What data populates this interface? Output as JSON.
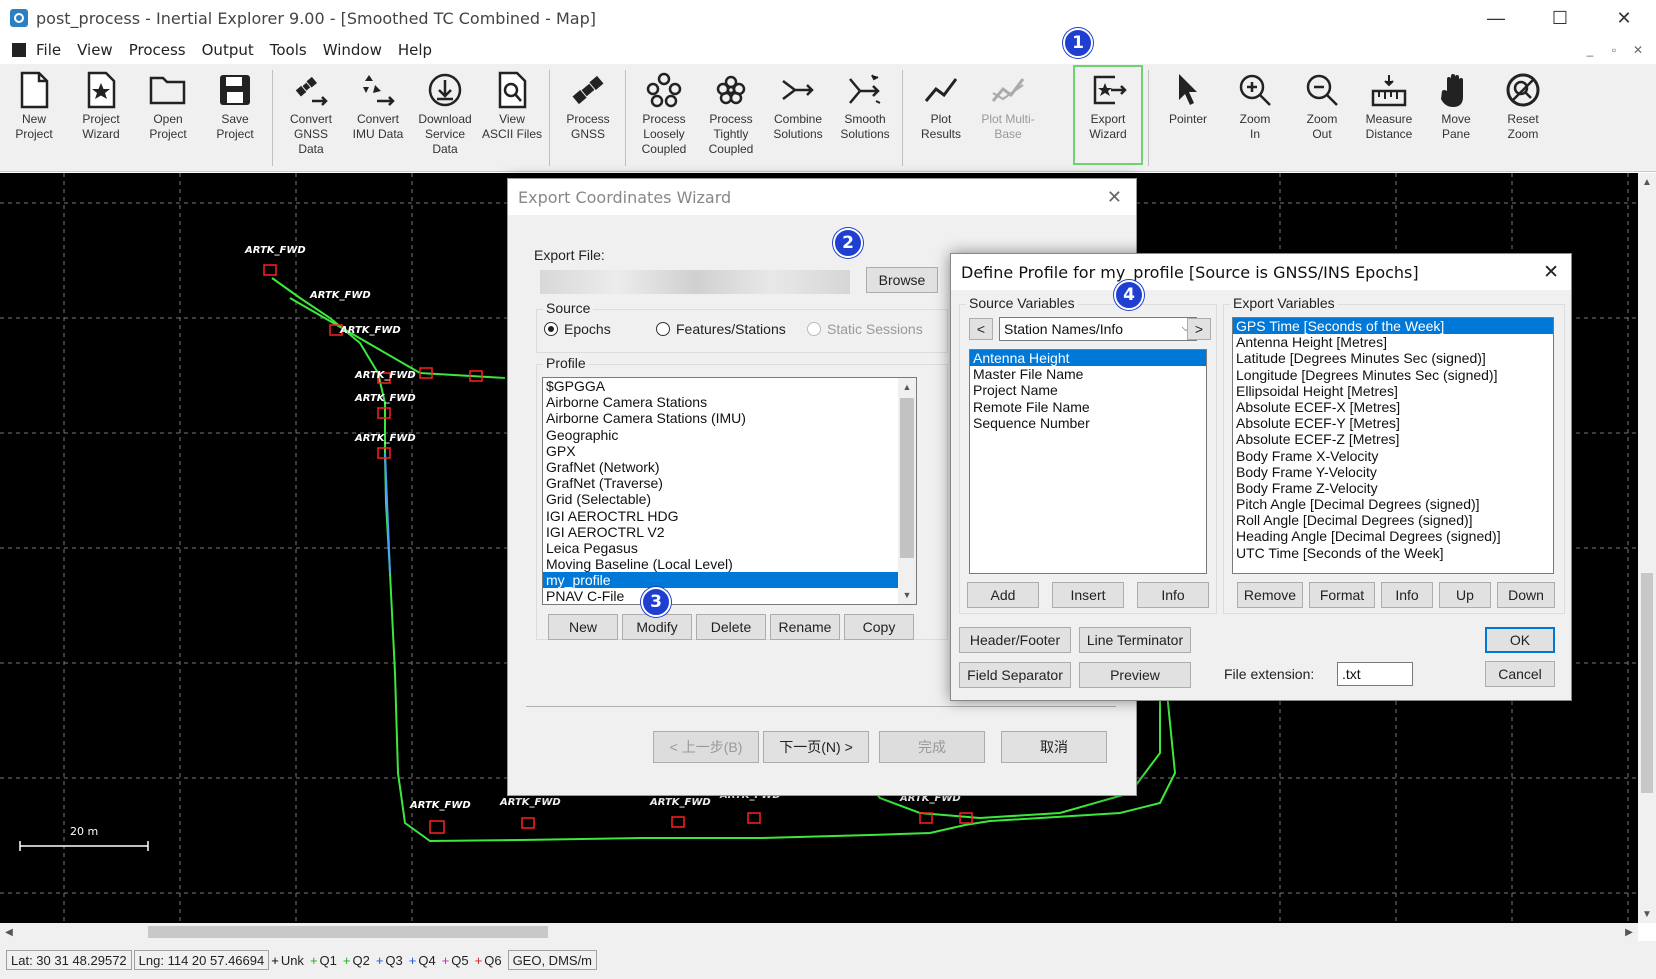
{
  "window": {
    "title": "post_process - Inertial Explorer 9.00 - [Smoothed TC Combined - Map]",
    "minimize": "—",
    "maximize": "☐",
    "close": "✕"
  },
  "menu": [
    "File",
    "View",
    "Process",
    "Output",
    "Tools",
    "Window",
    "Help"
  ],
  "mdi_controls": [
    "_",
    "▫",
    "✕"
  ],
  "toolbar": [
    {
      "id": "new-project",
      "label": "New\nProject",
      "icon": "document-icon"
    },
    {
      "id": "project-wizard",
      "label": "Project\nWizard",
      "icon": "star-document-icon"
    },
    {
      "id": "open-project",
      "label": "Open\nProject",
      "icon": "folder-icon"
    },
    {
      "id": "save-project",
      "label": "Save\nProject",
      "icon": "floppy-icon"
    },
    {
      "id": "convert-gnss",
      "label": "Convert\nGNSS\nData",
      "icon": "satellite-convert-icon"
    },
    {
      "id": "convert-imu",
      "label": "Convert\nIMU Data",
      "icon": "imu-convert-icon"
    },
    {
      "id": "download-service",
      "label": "Download\nService\nData",
      "icon": "download-icon"
    },
    {
      "id": "view-ascii",
      "label": "View\nASCII Files",
      "icon": "view-file-icon"
    },
    {
      "id": "process-gnss",
      "label": "Process\nGNSS",
      "icon": "satellite-icon"
    },
    {
      "id": "process-loosely",
      "label": "Process\nLoosely\nCoupled",
      "icon": "loose-coupled-icon"
    },
    {
      "id": "process-tightly",
      "label": "Process\nTightly\nCoupled",
      "icon": "tight-coupled-icon"
    },
    {
      "id": "combine-solutions",
      "label": "Combine\nSolutions",
      "icon": "merge-arrow-icon"
    },
    {
      "id": "smooth-solutions",
      "label": "Smooth\nSolutions",
      "icon": "smooth-arrow-icon"
    },
    {
      "id": "plot-results",
      "label": "Plot\nResults",
      "icon": "line-plot-icon"
    },
    {
      "id": "plot-multi-base",
      "label": "Plot Multi-\nBase",
      "icon": "multi-plot-icon",
      "disabled": true
    },
    {
      "id": "export-wizard",
      "label": "Export\nWizard",
      "icon": "export-icon"
    },
    {
      "id": "pointer",
      "label": "Pointer",
      "icon": "pointer-icon"
    },
    {
      "id": "zoom-in",
      "label": "Zoom\nIn",
      "icon": "zoom-in-icon"
    },
    {
      "id": "zoom-out",
      "label": "Zoom\nOut",
      "icon": "zoom-out-icon"
    },
    {
      "id": "measure-distance",
      "label": "Measure\nDistance",
      "icon": "ruler-icon"
    },
    {
      "id": "move-pane",
      "label": "Move\nPane",
      "icon": "hand-icon"
    },
    {
      "id": "reset-zoom",
      "label": "Reset\nZoom",
      "icon": "reset-zoom-icon"
    }
  ],
  "map": {
    "scale_label": "20 m",
    "marker_label": "ARTK_FWD"
  },
  "status": {
    "lat": "Lat: 30 31 48.29572",
    "lng": "Lng: 114 20 57.46694",
    "qualities": [
      {
        "label": "Unk",
        "color": "#000000"
      },
      {
        "label": "Q1",
        "color": "#22aa22"
      },
      {
        "label": "Q2",
        "color": "#22aa22"
      },
      {
        "label": "Q3",
        "color": "#2255dd"
      },
      {
        "label": "Q4",
        "color": "#2255dd"
      },
      {
        "label": "Q5",
        "color": "#cc22cc"
      },
      {
        "label": "Q6",
        "color": "#cc2222"
      }
    ],
    "format": "GEO, DMS/m"
  },
  "wizard": {
    "title": "Export Coordinates Wizard",
    "export_file_label": "Export File:",
    "browse": "Browse",
    "source_title": "Source",
    "source_options": [
      {
        "label": "Epochs",
        "selected": true
      },
      {
        "label": "Features/Stations",
        "selected": false
      },
      {
        "label": "Static Sessions",
        "selected": false,
        "disabled": true
      }
    ],
    "profile_title": "Profile",
    "profiles": [
      "$GPGGA",
      "Airborne Camera Stations",
      "Airborne Camera Stations (IMU)",
      "Geographic",
      "GPX",
      "GrafNet (Network)",
      "GrafNet (Traverse)",
      "Grid (Selectable)",
      "IGI AEROCTRL HDG",
      "IGI AEROCTRL V2",
      "Leica Pegasus",
      "Moving Baseline (Local Level)",
      "my_profile",
      "PNAV C-File"
    ],
    "selected_profile": "my_profile",
    "profile_buttons": [
      "New",
      "Modify",
      "Delete",
      "Rename",
      "Copy"
    ],
    "nav_buttons": [
      "< 上一步(B)",
      "下一页(N) >",
      "完成",
      "取消"
    ]
  },
  "profile_dialog": {
    "title": "Define Profile for my_profile [Source is GNSS/INS Epochs]",
    "source_vars_title": "Source Variables",
    "prev": "<",
    "next": ">",
    "category": "Station Names/Info",
    "source_vars": [
      "Antenna Height",
      "Master File Name",
      "Project Name",
      "Remote File Name",
      "Sequence Number"
    ],
    "selected_source_var": "Antenna Height",
    "source_buttons": [
      "Add",
      "Insert",
      "Info"
    ],
    "export_vars_title": "Export Variables",
    "export_vars": [
      "GPS Time [Seconds of the Week]",
      "Antenna Height [Metres]",
      "Latitude [Degrees Minutes Sec (signed)]",
      "Longitude [Degrees Minutes Sec (signed)]",
      "Ellipsoidal Height [Metres]",
      "Absolute ECEF-X [Metres]",
      "Absolute ECEF-Y [Metres]",
      "Absolute ECEF-Z [Metres]",
      "Body Frame X-Velocity",
      "Body Frame Y-Velocity",
      "Body Frame Z-Velocity",
      "Pitch Angle [Decimal Degrees (signed)]",
      "Roll Angle [Decimal Degrees (signed)]",
      "Heading Angle [Decimal Degrees (signed)]",
      "UTC Time [Seconds of the Week]"
    ],
    "selected_export_var": "GPS Time [Seconds of the Week]",
    "export_buttons": [
      "Remove",
      "Format",
      "Info",
      "Up",
      "Down"
    ],
    "header_footer": "Header/Footer",
    "line_terminator": "Line Terminator",
    "field_separator": "Field Separator",
    "preview": "Preview",
    "file_ext_label": "File extension:",
    "file_ext_value": ".txt",
    "ok": "OK",
    "cancel": "Cancel"
  },
  "badges": [
    "1",
    "2",
    "3",
    "4"
  ],
  "colors": {
    "badge": "#1f3fd0",
    "selection": "#0078d7",
    "highlight_border": "#6fd36f",
    "track": "#3ce83c",
    "marker": "#ff2020"
  }
}
